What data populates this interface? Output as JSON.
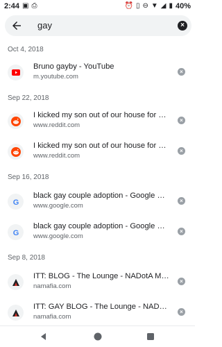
{
  "status": {
    "time": "2:44",
    "battery_percent": "40%"
  },
  "search": {
    "query": "gay"
  },
  "sections": [
    {
      "date": "Oct 4, 2018",
      "items": [
        {
          "title": "Bruno gayby - YouTube",
          "url": "m.youtube.com",
          "favicon": "youtube-icon"
        }
      ]
    },
    {
      "date": "Sep 22, 2018",
      "items": [
        {
          "title": "I kicked my son out of our house for being gay",
          "url": "www.reddit.com",
          "favicon": "reddit-icon"
        },
        {
          "title": "I kicked my son out of our house for being gay",
          "url": "www.reddit.com",
          "favicon": "reddit-icon"
        }
      ]
    },
    {
      "date": "Sep 16, 2018",
      "items": [
        {
          "title": "black gay couple adoption - Google Search",
          "url": "www.google.com",
          "favicon": "google-icon"
        },
        {
          "title": "black gay couple adoption - Google Search",
          "url": "www.google.com",
          "favicon": "google-icon"
        }
      ]
    },
    {
      "date": "Sep 8, 2018",
      "items": [
        {
          "title": "ITT: BLOG - The Lounge - NADotA Mafia",
          "url": "namafia.com",
          "favicon": "namafia-icon"
        },
        {
          "title": "ITT: GAY BLOG - The Lounge - NADotA Mafia",
          "url": "namafia.com",
          "favicon": "namafia-icon"
        }
      ]
    }
  ],
  "colors": {
    "youtube": "#ff0000",
    "reddit": "#ff4500",
    "google_blue": "#4285f4",
    "muted": "#5f6368"
  }
}
